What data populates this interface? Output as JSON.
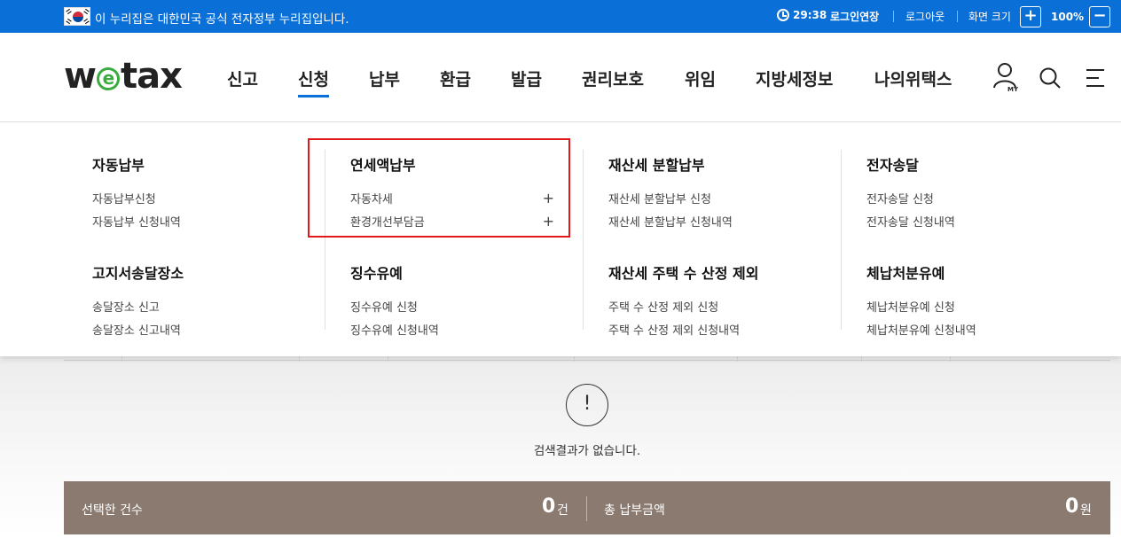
{
  "banner": {
    "text": "이 누리집은 대한민국 공식 전자정부 누리집입니다.",
    "timer": "29:38",
    "extend_label": "로그인연장",
    "logout_label": "로그아웃",
    "zoom_label": "화면 크기",
    "zoom_value": "100%",
    "zoom_in": "+",
    "zoom_out": "−"
  },
  "header": {
    "logo_w": "w",
    "logo_e": "e",
    "logo_rest": "tax",
    "nav": [
      "신고",
      "신청",
      "납부",
      "환급",
      "발급",
      "권리보호",
      "위임",
      "지방세정보",
      "나의위택스"
    ],
    "active_nav": "신청",
    "my_label": "MY"
  },
  "mega_menu": {
    "groups": [
      {
        "title": "자동납부",
        "items": [
          "자동납부신청",
          "자동납부 신청내역"
        ]
      },
      {
        "title": "연세액납부",
        "items": [
          "자동차세",
          "환경개선부담금"
        ],
        "expandable": true
      },
      {
        "title": "재산세 분할납부",
        "items": [
          "재산세 분할납부 신청",
          "재산세 분할납부 신청내역"
        ]
      },
      {
        "title": "전자송달",
        "items": [
          "전자송달 신청",
          "전자송달 신청내역"
        ]
      },
      {
        "title": "고지서송달장소",
        "items": [
          "송달장소 신고",
          "송달장소 신고내역"
        ]
      },
      {
        "title": "징수유예",
        "items": [
          "징수유예 신청",
          "징수유예 신청내역"
        ]
      },
      {
        "title": "재산세 주택 수 산정 제외",
        "items": [
          "주택 수 산정 제외 신청",
          "주택 수 산정 제외 신청내역"
        ]
      },
      {
        "title": "체납처분유예",
        "items": [
          "체납처분유예 신청",
          "체납처분유예 신청내역"
        ]
      }
    ],
    "plus_symbol": "+",
    "highlight_color": "#e01a1a"
  },
  "content": {
    "notice_symbol": "!",
    "empty_message": "검색결과가 없습니다.",
    "summary": {
      "selected_label": "선택한 건수",
      "selected_count": "0",
      "selected_unit": "건",
      "total_label": "총 납부금액",
      "total_amount": "0",
      "total_unit": "원"
    }
  },
  "colors": {
    "brand_blue": "#0a6fd6",
    "logo_green": "#3aab3e",
    "summary_bg": "#8a7a70"
  }
}
